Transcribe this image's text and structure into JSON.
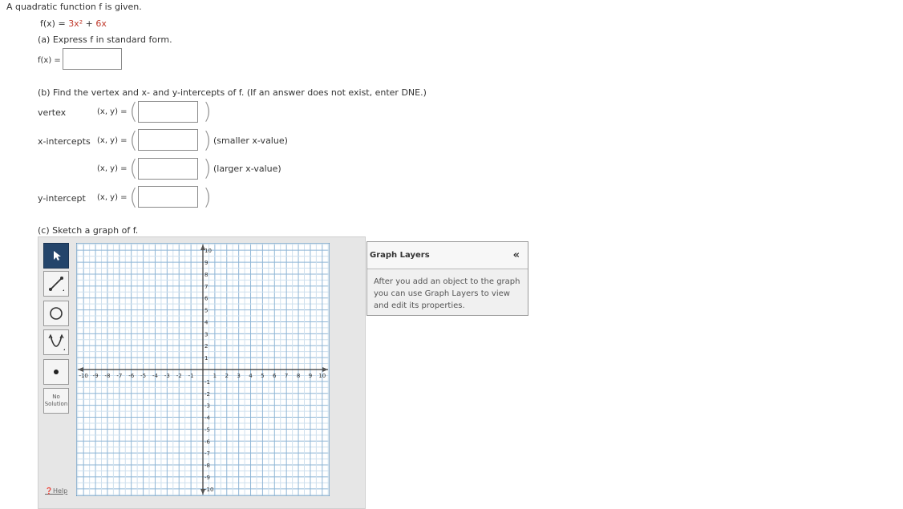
{
  "intro": "A quadratic function f is given.",
  "function": {
    "lhs": "f(x) = ",
    "term1": "3x²",
    "plus": " + ",
    "term2": "6x"
  },
  "part_a": {
    "prompt": "(a) Express f in standard form.",
    "fx_label": "f(x) =",
    "value": ""
  },
  "part_b": {
    "prompt": "(b) Find the vertex and x- and y-intercepts of f. (If an answer does not exist, enter DNE.)",
    "rows": [
      {
        "label": "vertex",
        "xy": "(x, y) =",
        "value": "",
        "note": ""
      },
      {
        "label": "x-intercepts",
        "xy": "(x, y) =",
        "value": "",
        "note": "(smaller x-value)"
      },
      {
        "label": "",
        "xy": "(x, y) =",
        "value": "",
        "note": "(larger x-value)"
      },
      {
        "label": "y-intercept",
        "xy": "(x, y) =",
        "value": "",
        "note": ""
      }
    ]
  },
  "part_c": {
    "prompt": "(c) Sketch a graph of f."
  },
  "toolbar": {
    "tools": [
      "select-tool",
      "line-tool",
      "circle-tool",
      "parabola-tool",
      "point-tool",
      "no-solution-tool"
    ],
    "no_solution_label": [
      "No",
      "Solution"
    ],
    "help_label": "Help"
  },
  "graph": {
    "x_ticks": [
      "-10",
      "-9",
      "-8",
      "-7",
      "-6",
      "-5",
      "-4",
      "-3",
      "-2",
      "-1",
      "1",
      "2",
      "3",
      "4",
      "5",
      "6",
      "7",
      "8",
      "9",
      "10"
    ],
    "y_ticks": [
      "10",
      "9",
      "8",
      "7",
      "6",
      "5",
      "4",
      "3",
      "2",
      "1",
      "-1",
      "-2",
      "-3",
      "-4",
      "-5",
      "-6",
      "-7",
      "-8",
      "-9",
      "-10"
    ],
    "x_range": [
      -10,
      10
    ],
    "y_range": [
      -10,
      10
    ],
    "grid": true
  },
  "layers": {
    "title": "Graph Layers",
    "collapse_glyph": "«",
    "body": "After you add an object to the graph you can use Graph Layers to view and edit its properties."
  },
  "colors": {
    "active_tool": "#24456b",
    "grid": "#9fc3df",
    "axis": "#333333"
  }
}
